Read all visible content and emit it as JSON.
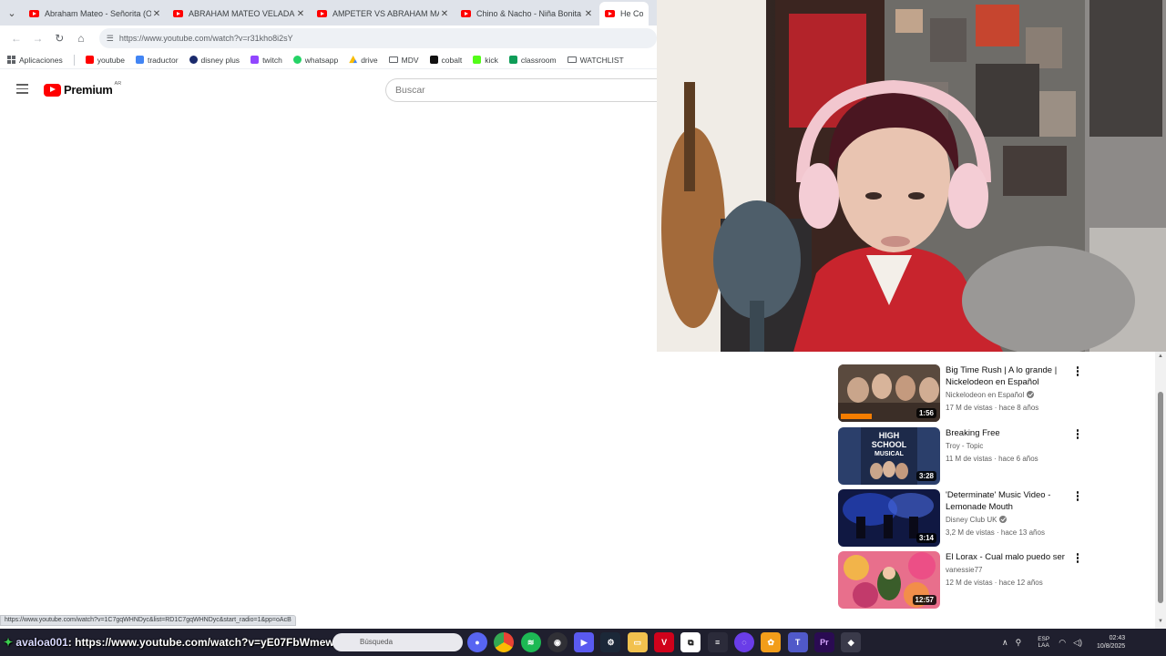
{
  "browser": {
    "tabs": [
      {
        "title": "Abraham Mateo - Señorita (Of",
        "active": false
      },
      {
        "title": "ABRAHAM MATEO VELADA - Y",
        "active": false
      },
      {
        "title": "AMPETER VS ABRAHAM MATE",
        "active": false
      },
      {
        "title": "Chino & Nacho - Niña Bonita -",
        "active": false
      },
      {
        "title": "He Could B",
        "active": true
      }
    ],
    "url": "https://www.youtube.com/watch?v=r31kho8i2sY",
    "bookmarks": [
      {
        "label": "Aplicaciones",
        "icon": "apps-grid-icon"
      },
      {
        "label": "youtube",
        "icon": "youtube-icon",
        "color": "#ff0000"
      },
      {
        "label": "traductor",
        "icon": "translate-icon",
        "color": "#4285f4"
      },
      {
        "label": "disney plus",
        "icon": "disney-icon",
        "color": "#1a2a6c"
      },
      {
        "label": "twitch",
        "icon": "twitch-icon",
        "color": "#9146ff"
      },
      {
        "label": "whatsapp",
        "icon": "whatsapp-icon",
        "color": "#25d366"
      },
      {
        "label": "drive",
        "icon": "drive-icon",
        "color": "#fbbc04"
      },
      {
        "label": "MDV",
        "icon": "folder-icon"
      },
      {
        "label": "cobalt",
        "icon": "cobalt-icon",
        "color": "#111111"
      },
      {
        "label": "kick",
        "icon": "kick-icon",
        "color": "#53fc18"
      },
      {
        "label": "classroom",
        "icon": "classroom-icon",
        "color": "#0f9d58"
      },
      {
        "label": "WATCHLIST",
        "icon": "folder-icon"
      }
    ]
  },
  "youtube": {
    "logo_text": "Premium",
    "region": "AR",
    "search_placeholder": "Buscar"
  },
  "recommendations": [
    {
      "title": "Big Time Rush | A lo grande | Nickelodeon en Español",
      "channel": "Nickelodeon en Español",
      "verified": true,
      "meta": "17 M de vistas · hace 8 años",
      "duration": "1:56",
      "thumb_color": "#5a4a3e"
    },
    {
      "title": "Breaking Free",
      "channel": "Troy - Topic",
      "verified": false,
      "meta": "11 M de vistas · hace 6 años",
      "duration": "3:28",
      "thumb_color": "#2b3f6b"
    },
    {
      "title": "'Determinate' Music Video - Lemonade Mouth",
      "channel": "Disney Club UK",
      "verified": true,
      "meta": "3,2 M de vistas · hace 13 años",
      "duration": "3:14",
      "thumb_color": "#1a2a7a"
    },
    {
      "title": "El Lorax - Cual malo puedo ser",
      "channel": "vanessie77",
      "verified": false,
      "meta": "12 M de vistas · hace 12 años",
      "duration": "12:57",
      "thumb_color": "#d4466a"
    }
  ],
  "status_link": "https://www.youtube.com/watch?v=1C7gqWHNDyc&list=RD1C7gqWHNDyc&start_radio=1&pp=oAcB",
  "overlay_chat": {
    "user": "avaloa001",
    "message": ": https://www.youtube.com/watch?v=yE07FbWmew8"
  },
  "taskbar": {
    "search_placeholder": "Búsqueda",
    "lang_top": "ESP",
    "lang_bottom": "LAA",
    "time": "02:43",
    "date": "10/8/2025"
  }
}
